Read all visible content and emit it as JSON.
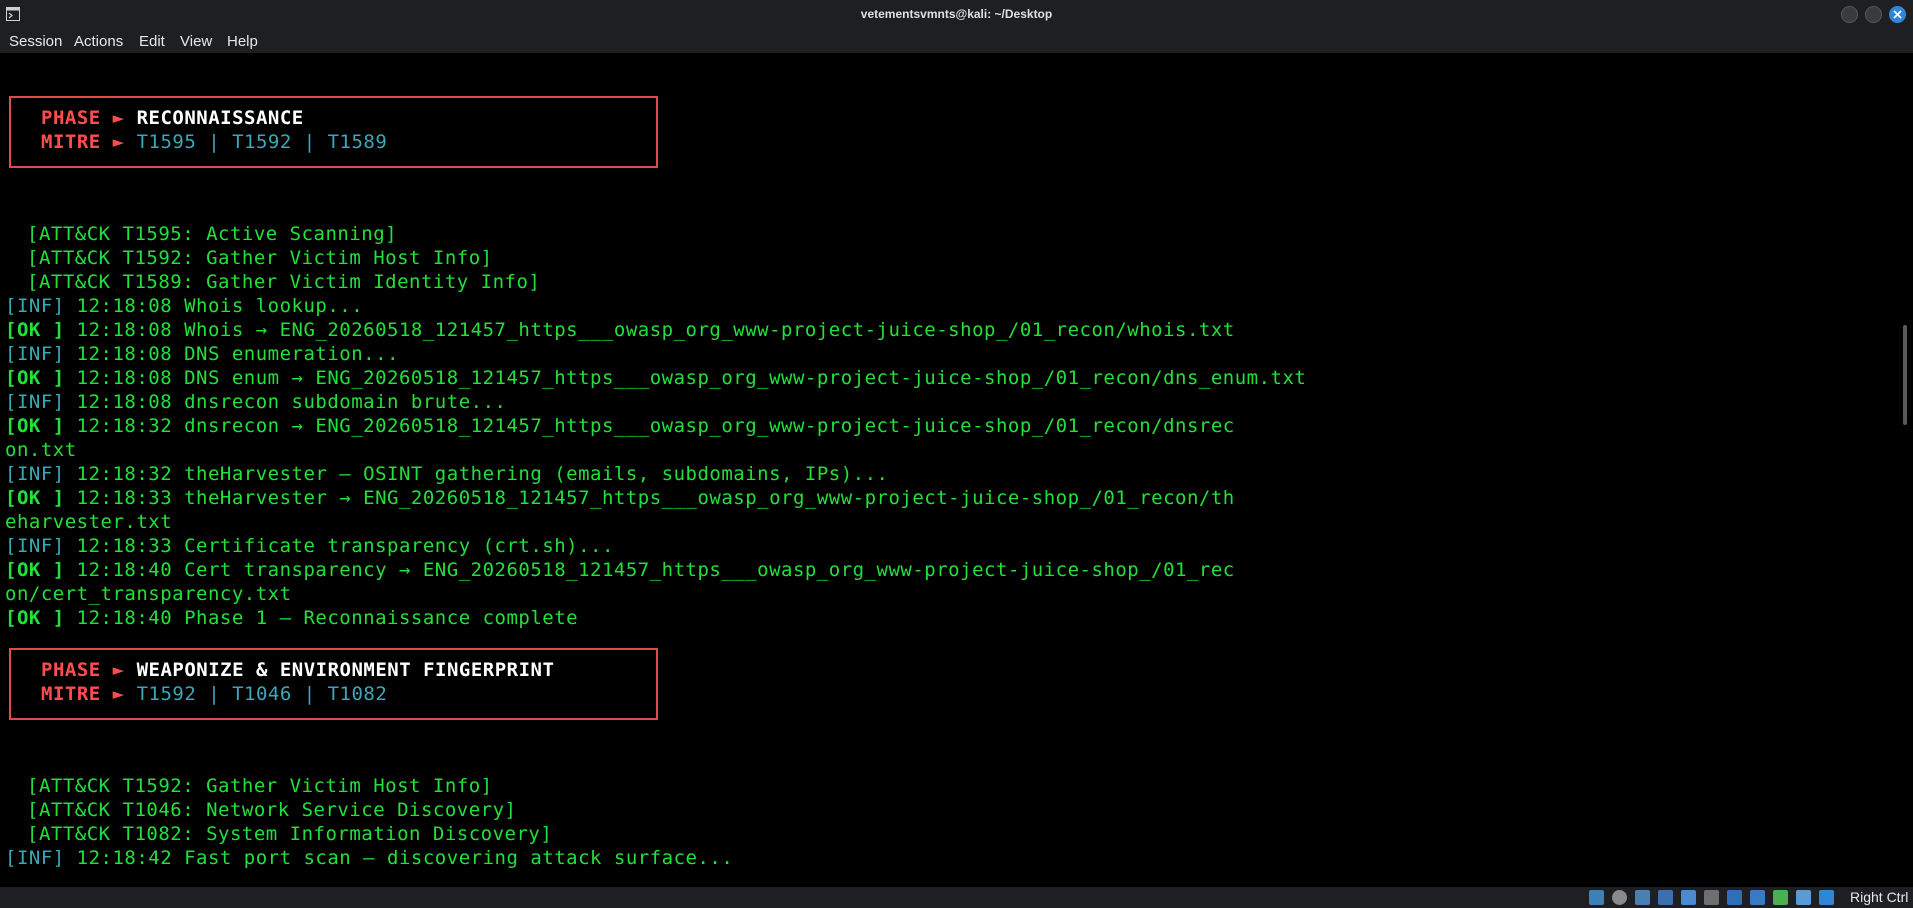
{
  "window": {
    "title": "vetementsvmnts@kali: ~/Desktop",
    "accent": "#2f86d6"
  },
  "menu": [
    "Session",
    "Actions",
    "Edit",
    "View",
    "Help"
  ],
  "colors": {
    "background": "#000000",
    "ok_green": "#22e03b",
    "inf_cyan": "#3aa8b8",
    "banner_red": "#ff4d4d"
  },
  "banners": [
    {
      "phase_label": "PHASE",
      "arrow": "►",
      "phase_name": "RECONNAISSANCE",
      "mitre_label": "MITRE",
      "techniques": "T1595 | T1592 | T1589"
    },
    {
      "phase_label": "PHASE",
      "arrow": "►",
      "phase_name": "WEAPONIZE & ENVIRONMENT FINGERPRINT",
      "mitre_label": "MITRE",
      "techniques": "T1592 | T1046 | T1082"
    }
  ],
  "lines": [
    {
      "attack": "[ATT&CK T1595: Active Scanning]"
    },
    {
      "attack": "[ATT&CK T1592: Gather Victim Host Info]"
    },
    {
      "attack": "[ATT&CK T1589: Gather Victim Identity Info]"
    },
    {
      "tag": "[INF]",
      "text": " 12:18:08 Whois lookup..."
    },
    {
      "tag": "[OK ]",
      "text": " 12:18:08 Whois → ENG_20260518_121457_https___owasp_org_www-project-juice-shop_/01_recon/whois.txt"
    },
    {
      "tag": "[INF]",
      "text": " 12:18:08 DNS enumeration..."
    },
    {
      "tag": "[OK ]",
      "text": " 12:18:08 DNS enum → ENG_20260518_121457_https___owasp_org_www-project-juice-shop_/01_recon/dns_enum.txt"
    },
    {
      "tag": "[INF]",
      "text": " 12:18:08 dnsrecon subdomain brute..."
    },
    {
      "tag": "[OK ]",
      "text": " 12:18:32 dnsrecon → ENG_20260518_121457_https___owasp_org_www-project-juice-shop_/01_recon/dnsrec"
    },
    {
      "cont": "on.txt"
    },
    {
      "tag": "[INF]",
      "text": " 12:18:32 theHarvester — OSINT gathering (emails, subdomains, IPs)..."
    },
    {
      "tag": "[OK ]",
      "text": " 12:18:33 theHarvester → ENG_20260518_121457_https___owasp_org_www-project-juice-shop_/01_recon/th"
    },
    {
      "cont": "eharvester.txt"
    },
    {
      "tag": "[INF]",
      "text": " 12:18:33 Certificate transparency (crt.sh)..."
    },
    {
      "tag": "[OK ]",
      "text": " 12:18:40 Cert transparency → ENG_20260518_121457_https___owasp_org_www-project-juice-shop_/01_rec"
    },
    {
      "cont": "on/cert_transparency.txt"
    },
    {
      "tag": "[OK ]",
      "text": " 12:18:40 Phase 1 — Reconnaissance complete"
    },
    {
      "attack": "[ATT&CK T1592: Gather Victim Host Info]"
    },
    {
      "attack": "[ATT&CK T1046: Network Service Discovery]"
    },
    {
      "attack": "[ATT&CK T1082: System Information Discovery]"
    },
    {
      "tag": "[INF]",
      "text": " 12:18:42 Fast port scan — discovering attack surface..."
    }
  ],
  "taskbar": {
    "host_key": "Right Ctrl",
    "tray_icons": [
      "network-icon",
      "optical-drive-icon",
      "audio-icon",
      "usb-icon",
      "shared-folder-icon",
      "storage-icon",
      "display-icon",
      "screen-capture-icon",
      "mouse-integration-icon",
      "cpu-icon",
      "download-icon"
    ]
  }
}
